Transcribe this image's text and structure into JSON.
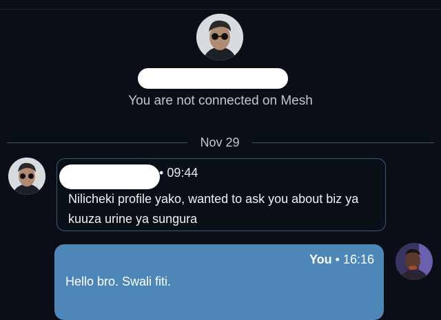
{
  "header": {
    "connection_status": "You are not connected on Mesh"
  },
  "divider": {
    "date": "Nov 29"
  },
  "messages": [
    {
      "direction": "incoming",
      "time": "09:44",
      "separator": "•",
      "text": "Nilicheki profile yako, wanted to ask you about biz ya kuuza urine ya sungura"
    },
    {
      "direction": "outgoing",
      "sender": "You",
      "separator": "•",
      "time": "16:16",
      "text": "Hello bro. Swali fiti."
    }
  ],
  "colors": {
    "background": "#0a0f17",
    "outgoing_bubble": "#4d87b8",
    "incoming_border": "#3b5a7a"
  }
}
